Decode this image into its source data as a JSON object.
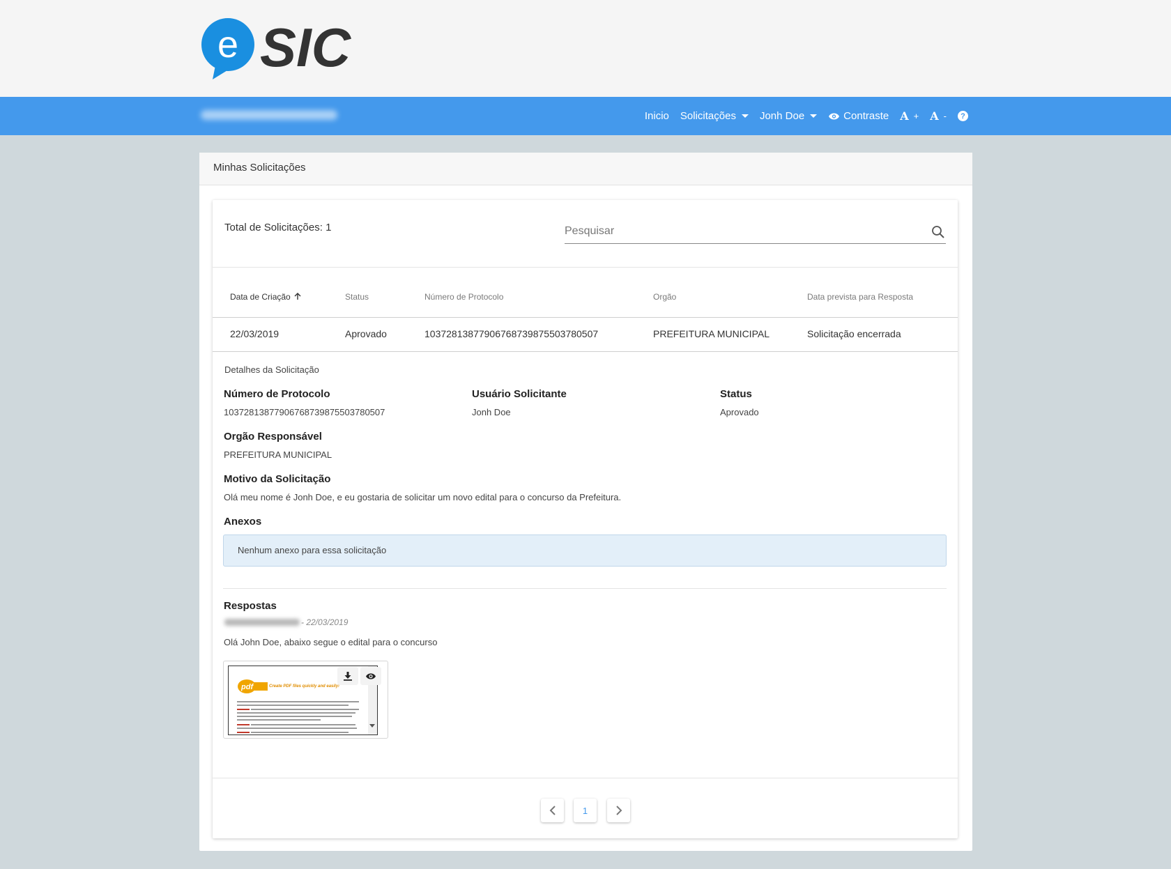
{
  "logo": {
    "letter": "e",
    "text": "SIC",
    "colors": {
      "bubble": "#1a8fe0",
      "text": "#333333"
    }
  },
  "navbar": {
    "color": "#4499ec",
    "items": {
      "inicio": "Inicio",
      "solicitacoes": "Solicitações",
      "user": "Jonh Doe",
      "contraste": "Contraste",
      "font_increase": "A",
      "font_increase_sign": "+",
      "font_decrease": "A",
      "font_decrease_sign": "-",
      "help": "?"
    }
  },
  "page_title": "Minhas Solicitações",
  "list": {
    "total_label": "Total de Solicitações: 1",
    "search_placeholder": "Pesquisar",
    "columns": [
      "Data de Criação",
      "Status",
      "Número de Protocolo",
      "Orgão",
      "Data prevista para Resposta"
    ],
    "rows": [
      {
        "data_criacao": "22/03/2019",
        "status": "Aprovado",
        "protocolo": "10372813877906768739875503780507",
        "orgao": "PREFEITURA MUNICIPAL",
        "data_prevista": "Solicitação encerrada"
      }
    ]
  },
  "details": {
    "title": "Detalhes da Solicitação",
    "protocolo_label": "Número de Protocolo",
    "protocolo_value": "10372813877906768739875503780507",
    "usuario_label": "Usuário Solicitante",
    "usuario_value": "Jonh Doe",
    "status_label": "Status",
    "status_value": "Aprovado",
    "orgao_label": "Orgão Responsável",
    "orgao_value": "PREFEITURA MUNICIPAL",
    "motivo_label": "Motivo da Solicitação",
    "motivo_value": "Olá meu nome é Jonh Doe, e eu gostaria de solicitar um novo edital para o concurso da Prefeitura.",
    "anexos_label": "Anexos",
    "anexos_empty": "Nenhum anexo para essa solicitação"
  },
  "respostas": {
    "label": "Respostas",
    "date": "- 22/03/2019",
    "text": "Olá John Doe, abaixo segue o edital para o concurso",
    "attachment": {
      "logo_text": "pdf",
      "tagline": "Create PDF files quickly and easily!"
    }
  },
  "pagination": {
    "current": "1"
  }
}
